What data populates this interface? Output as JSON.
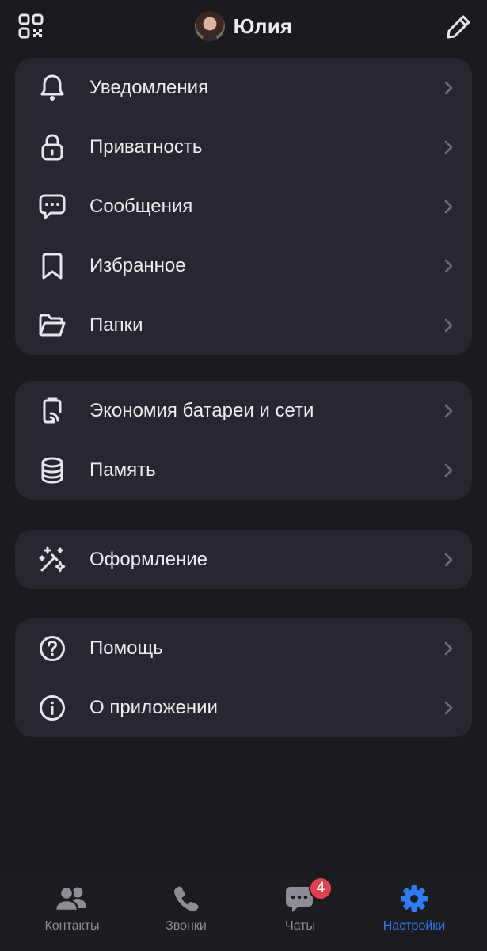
{
  "header": {
    "name": "Юлия"
  },
  "groups": [
    {
      "items": [
        {
          "label": "Уведомления",
          "icon": "bell-icon"
        },
        {
          "label": "Приватность",
          "icon": "lock-icon"
        },
        {
          "label": "Сообщения",
          "icon": "message-bubble-icon"
        },
        {
          "label": "Избранное",
          "icon": "bookmark-icon"
        },
        {
          "label": "Папки",
          "icon": "folder-icon"
        }
      ]
    },
    {
      "items": [
        {
          "label": "Экономия батареи и сети",
          "icon": "battery-saver-icon"
        },
        {
          "label": "Память",
          "icon": "database-icon"
        }
      ]
    },
    {
      "items": [
        {
          "label": "Оформление",
          "icon": "magic-wand-icon"
        }
      ]
    },
    {
      "items": [
        {
          "label": "Помощь",
          "icon": "question-circle-icon"
        },
        {
          "label": "О приложении",
          "icon": "info-circle-icon"
        }
      ]
    }
  ],
  "tabbar": {
    "tabs": [
      {
        "label": "Контакты",
        "icon": "contacts-icon"
      },
      {
        "label": "Звонки",
        "icon": "phone-icon"
      },
      {
        "label": "Чаты",
        "icon": "chat-icon",
        "badge": "4"
      },
      {
        "label": "Настройки",
        "icon": "gear-icon",
        "active": true
      }
    ]
  },
  "colors": {
    "background": "#1a1b1f",
    "card": "#27282f",
    "accent": "#2f7bf5",
    "badge": "#e0414c"
  }
}
